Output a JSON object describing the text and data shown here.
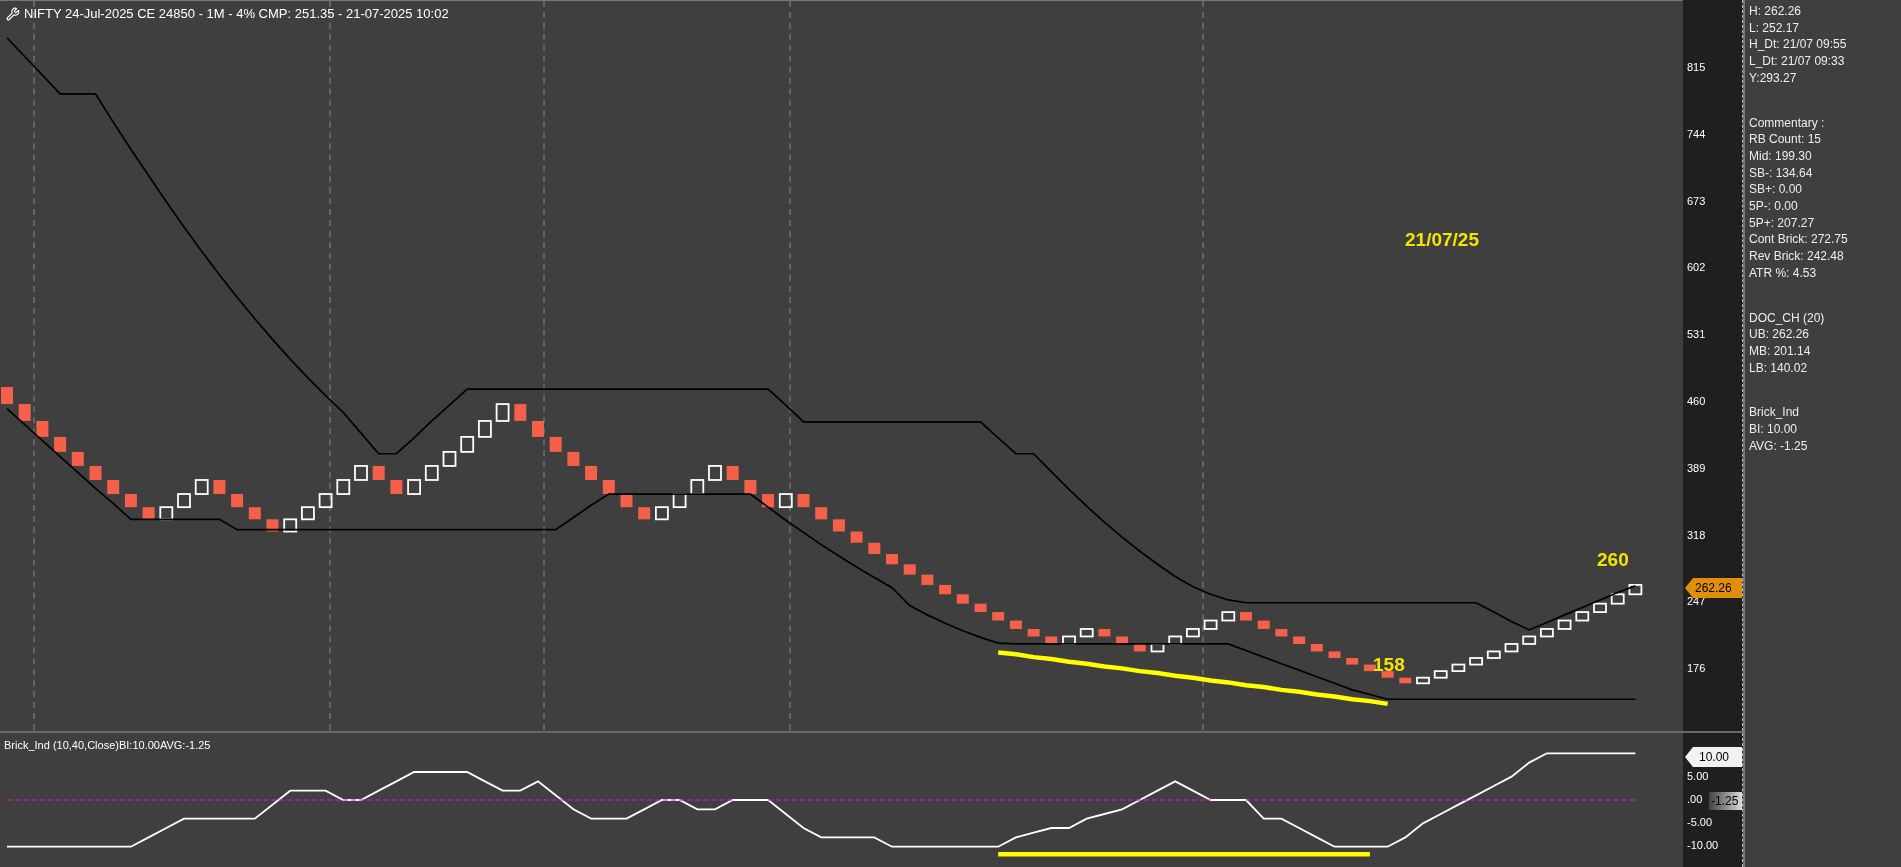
{
  "title": "NIFTY 24-Jul-2025 CE 24850 - 1M - 4% CMP: 251.35 - 21-07-2025 10:02",
  "price_chart": {
    "annotations": [
      "21/07/25",
      "158",
      "260"
    ],
    "price_tag": "262.26",
    "chart_data": {
      "type": "line",
      "categories": [
        null,
        null,
        null,
        null,
        null,
        null,
        null,
        null,
        null,
        null,
        null,
        null,
        null,
        null,
        null,
        null,
        null,
        null,
        null,
        null,
        null,
        null,
        null,
        null,
        null,
        null,
        null,
        null,
        null,
        null,
        null,
        null,
        null,
        null,
        null,
        null,
        null,
        null,
        null,
        null,
        null,
        null,
        null,
        null,
        null,
        null,
        null,
        null,
        null,
        null,
        null,
        null,
        null,
        null,
        null,
        null,
        null,
        null,
        null,
        null,
        null,
        null,
        null,
        null,
        null,
        null,
        null,
        null,
        null,
        null,
        null,
        null,
        null,
        null,
        null,
        null,
        null,
        null,
        null,
        null,
        null,
        null,
        null,
        null,
        null,
        null,
        null,
        null,
        null,
        null,
        null,
        null,
        null
      ],
      "ylim": [
        107.1,
        886.2
      ],
      "yticks": [
        815,
        744,
        673,
        602,
        531,
        460,
        389,
        318,
        247,
        176
      ],
      "series": [
        {
          "color": "#000000",
          "values": [
            847,
            827,
            807,
            787,
            787,
            787,
            757,
            728,
            700,
            672,
            645,
            619,
            594,
            570,
            547,
            525,
            504,
            484,
            465,
            447,
            425,
            403,
            403,
            420,
            438,
            455,
            472,
            472,
            472,
            472,
            472,
            472,
            472,
            472,
            472,
            472,
            472,
            472,
            472,
            472,
            472,
            472,
            472,
            472,
            455,
            437,
            437,
            437,
            437,
            437,
            437,
            437,
            437,
            437,
            437,
            437,
            420,
            403,
            403,
            384,
            365,
            347,
            330,
            314,
            299,
            285,
            272,
            261,
            253,
            247,
            244,
            244,
            244,
            244,
            244,
            244,
            244,
            244,
            244,
            244,
            244,
            244,
            244,
            244,
            234,
            224,
            215,
            223,
            231,
            239,
            247,
            255,
            262
          ]
        },
        {
          "color": "#000000",
          "values": [
            451,
            434,
            417,
            400,
            383,
            366,
            350,
            333,
            333,
            333,
            333,
            333,
            333,
            322,
            322,
            322,
            322,
            322,
            322,
            322,
            322,
            322,
            322,
            322,
            322,
            322,
            322,
            322,
            322,
            322,
            322,
            322,
            335,
            348,
            360,
            360,
            360,
            360,
            360,
            360,
            360,
            360,
            360,
            346,
            332,
            319,
            306,
            294,
            282,
            271,
            260,
            241,
            231,
            222,
            214,
            207,
            201,
            200,
            200,
            200,
            200,
            200,
            200,
            200,
            200,
            200,
            200,
            200,
            200,
            200,
            193,
            186,
            179,
            172,
            165,
            158,
            151,
            146,
            141,
            141,
            141,
            141,
            141,
            141,
            141,
            141,
            141,
            141,
            141,
            141,
            141,
            141,
            141
          ]
        },
        {
          "color": "#ffff00",
          "values": [
            null,
            null,
            null,
            null,
            null,
            null,
            null,
            null,
            null,
            null,
            null,
            null,
            null,
            null,
            null,
            null,
            null,
            null,
            null,
            null,
            null,
            null,
            null,
            null,
            null,
            null,
            null,
            null,
            null,
            null,
            null,
            null,
            null,
            null,
            null,
            null,
            null,
            null,
            null,
            null,
            null,
            null,
            null,
            null,
            null,
            null,
            null,
            null,
            null,
            null,
            null,
            null,
            null,
            null,
            null,
            null,
            191,
            189,
            186,
            184,
            181,
            179,
            176,
            174,
            171,
            169,
            166,
            164,
            161,
            159,
            156,
            154,
            151,
            149,
            146,
            144,
            141,
            139,
            136,
            null,
            null,
            null,
            null,
            null,
            null,
            null,
            null,
            null,
            null,
            null,
            null,
            null,
            null
          ]
        }
      ]
    }
  },
  "indicator": {
    "title": "Brick_Ind (10,40,Close)BI:10.00AVG:-1.25",
    "value_tag": "10.00",
    "avg_tag": "-1.25",
    "chart_data": {
      "type": "line",
      "categories": [
        null,
        null,
        null,
        null,
        null,
        null,
        null,
        null,
        null,
        null,
        null,
        null,
        null,
        null,
        null,
        null,
        null,
        null,
        null,
        null,
        null,
        null,
        null,
        null,
        null,
        null,
        null,
        null,
        null,
        null,
        null,
        null,
        null,
        null,
        null,
        null,
        null,
        null,
        null,
        null,
        null,
        null,
        null,
        null,
        null,
        null,
        null,
        null,
        null,
        null,
        null,
        null,
        null,
        null,
        null,
        null,
        null,
        null,
        null,
        null,
        null,
        null,
        null,
        null,
        null,
        null,
        null,
        null,
        null,
        null,
        null,
        null,
        null,
        null,
        null,
        null,
        null,
        null,
        null,
        null,
        null,
        null,
        null,
        null,
        null,
        null,
        null,
        null,
        null,
        null,
        null,
        null,
        null
      ],
      "ylim": [
        -14.35,
        14.35
      ],
      "yticks": [
        {
          "value": 5,
          "label": "5.00"
        },
        {
          "value": 0,
          "label": ".00"
        },
        {
          "value": -5,
          "label": "-5.00"
        },
        {
          "value": -10,
          "label": "-10.00"
        }
      ],
      "series": [
        {
          "color": "#ffffff",
          "values": [
            -10,
            -10,
            -10,
            -10,
            -10,
            -10,
            -10,
            -10,
            -8,
            -6,
            -4,
            -4,
            -4,
            -4,
            -4,
            -1,
            2,
            2,
            2,
            0,
            0,
            2,
            4,
            6,
            6,
            6,
            6,
            4,
            2,
            2,
            4,
            1,
            -2,
            -4,
            -4,
            -4,
            -2,
            0,
            0,
            -2,
            -2,
            0,
            0,
            0,
            -3,
            -6,
            -8,
            -8,
            -8,
            -8,
            -10,
            -10,
            -10,
            -10,
            -10,
            -10,
            -10,
            -8,
            -7,
            -6,
            -6,
            -4,
            -3,
            -2,
            0,
            2,
            4,
            2,
            0,
            0,
            0,
            -4,
            -4,
            -6,
            -8,
            -10,
            -10,
            -10,
            -10,
            -8,
            -5,
            -3,
            -1,
            1,
            3,
            5,
            8,
            10,
            10,
            10,
            10,
            10,
            10
          ]
        },
        {
          "color": "#ffff00",
          "values": [
            null,
            null,
            null,
            null,
            null,
            null,
            null,
            null,
            null,
            null,
            null,
            null,
            null,
            null,
            null,
            null,
            null,
            null,
            null,
            null,
            null,
            null,
            null,
            null,
            null,
            null,
            null,
            null,
            null,
            null,
            null,
            null,
            null,
            null,
            null,
            null,
            null,
            null,
            null,
            null,
            null,
            null,
            null,
            null,
            null,
            null,
            null,
            null,
            null,
            null,
            null,
            null,
            null,
            null,
            null,
            null,
            -11.6,
            -11.6,
            -11.6,
            -11.6,
            -11.6,
            -11.6,
            -11.6,
            -11.6,
            -11.6,
            -11.6,
            -11.6,
            -11.6,
            -11.6,
            -11.6,
            -11.6,
            -11.6,
            -11.6,
            -11.6,
            -11.6,
            -11.6,
            -11.6,
            -11.6,
            null,
            null,
            null,
            null,
            null,
            null,
            null,
            null,
            null,
            null,
            null,
            null,
            null,
            null,
            null
          ]
        },
        {
          "color": "#ff00ff",
          "line_style": "dashed",
          "values": [
            0,
            0,
            0,
            0,
            0,
            0,
            0,
            0,
            0,
            0,
            0,
            0,
            0,
            0,
            0,
            0,
            0,
            0,
            0,
            0,
            0,
            0,
            0,
            0,
            0,
            0,
            0,
            0,
            0,
            0,
            0,
            0,
            0,
            0,
            0,
            0,
            0,
            0,
            0,
            0,
            0,
            0,
            null,
            0,
            0,
            0,
            0,
            0,
            0,
            0,
            0,
            0,
            0,
            0,
            0,
            0,
            0,
            0,
            0,
            0,
            0,
            0,
            0,
            0,
            0,
            0,
            0,
            0,
            0,
            null,
            0,
            0,
            0,
            0,
            0,
            0,
            0,
            0,
            0,
            0,
            0,
            0,
            0,
            0,
            0,
            0,
            0,
            0,
            0,
            0,
            0,
            0,
            0
          ]
        }
      ]
    }
  },
  "info_panel": {
    "sections": [
      {
        "lines": [
          "H: 262.26",
          "L: 252.17",
          "H_Dt: 21/07 09:55",
          "L_Dt: 21/07 09:33",
          "Y:293.27"
        ]
      },
      {
        "lines": [
          "Commentary :",
          "RB Count: 15",
          "Mid: 199.30",
          "SB-: 134.64",
          "SB+: 0.00",
          "5P-: 0.00",
          "5P+: 207.27",
          "Cont Brick: 272.75",
          "Rev Brick: 242.48",
          "ATR %: 4.53"
        ]
      },
      {
        "lines": [
          "DOC_CH (20)",
          "UB: 262.26",
          "MB: 201.14",
          "LB: 140.02"
        ]
      },
      {
        "lines": [
          "Brick_Ind",
          "BI: 10.00",
          "AVG: -1.25"
        ]
      }
    ]
  }
}
